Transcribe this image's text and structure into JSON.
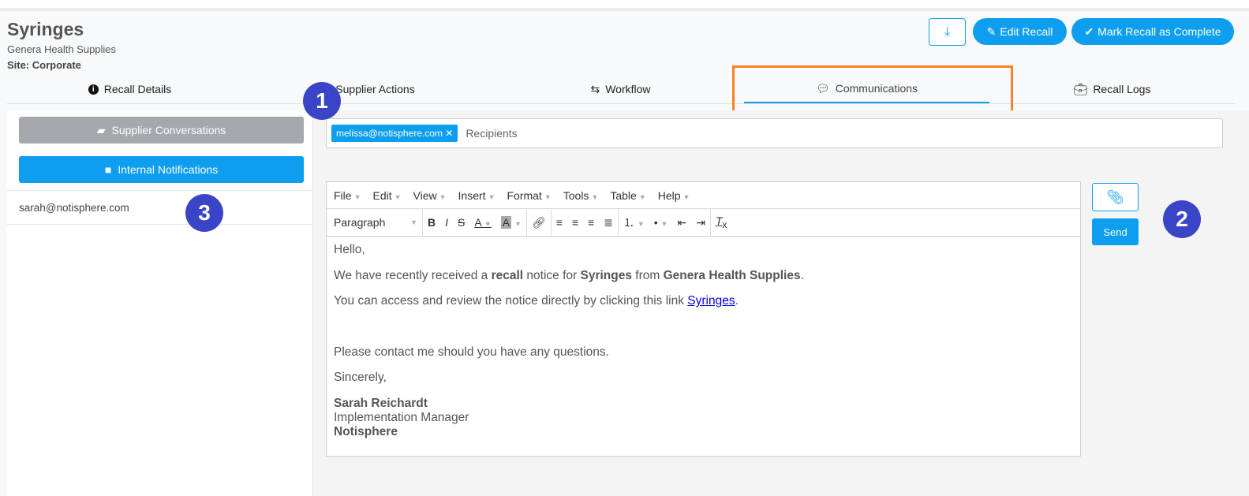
{
  "header": {
    "title": "Syringes",
    "supplier": "Genera Health Supplies",
    "site": "Site: Corporate",
    "edit_label": "Edit Recall",
    "complete_label": "Mark Recall as Complete"
  },
  "tabs": [
    "Recall Details",
    "Supplier Actions",
    "Workflow",
    "Communications",
    "Recall Logs"
  ],
  "sidebar": {
    "supplier_conv": "Supplier Conversations",
    "internal": "Internal Notifications",
    "items": [
      "sarah@notisphere.com"
    ]
  },
  "recipients": {
    "chip": "melissa@notisphere.com",
    "placeholder": "Recipients"
  },
  "editor": {
    "menus": [
      "File",
      "Edit",
      "View",
      "Insert",
      "Format",
      "Tools",
      "Table",
      "Help"
    ],
    "block_format": "Paragraph",
    "greeting": "Hello,",
    "l1a": "We have recently received a ",
    "l1b": "recall",
    "l1c": " notice for ",
    "l1d": "Syringes",
    "l1e": " from ",
    "l1f": "Genera Health Supplies",
    "l1g": ".",
    "l2a": "You can access and review the notice directly by clicking this link ",
    "l2link": "Syringes",
    "l2b": ".",
    "l3": "Please contact me should you have any questions.",
    "l4": "Sincerely,",
    "sig_name": "Sarah Reichardt",
    "sig_title": "Implementation Manager",
    "sig_company": "Notisphere"
  },
  "send_label": "Send",
  "badges": [
    "1",
    "2",
    "3"
  ],
  "colors": {
    "accent": "#0d9ef0",
    "badge": "#3a44c6",
    "highlight": "#f7822a"
  }
}
